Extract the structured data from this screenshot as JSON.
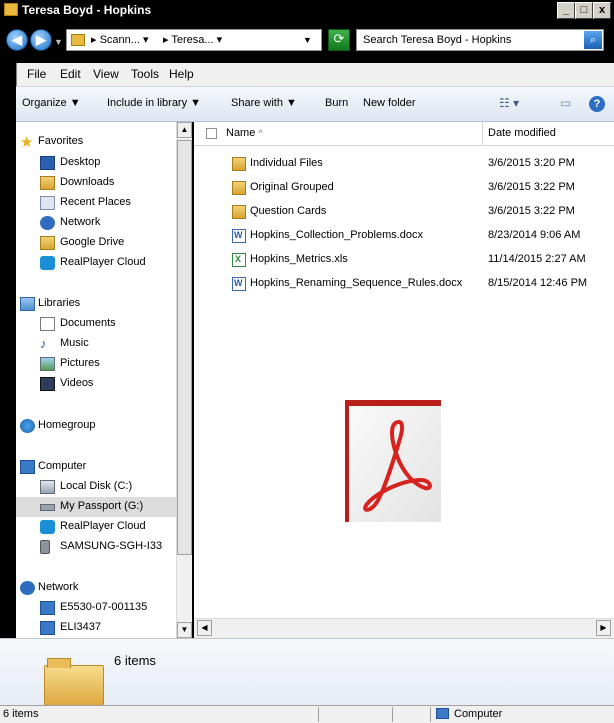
{
  "window": {
    "title": "Teresa Boyd - Hopkins",
    "buttons": {
      "minimize": "_",
      "maximize": "□",
      "close": "x"
    }
  },
  "address_bar": {
    "crumbs": [
      "▸ Scann... ▾",
      "▸ Teresa... ▾"
    ],
    "search_placeholder": "Search Teresa Boyd - Hopkins"
  },
  "menu": [
    "File",
    "Edit",
    "View",
    "Tools",
    "Help"
  ],
  "toolbar": {
    "organize": "Organize ▼",
    "include_in_library": "Include in library ▼",
    "share_with": "Share with ▼",
    "burn": "Burn",
    "new_folder": "New folder"
  },
  "nav": {
    "favorites_label": "Favorites",
    "favorites": [
      "Desktop",
      "Downloads",
      "Recent Places",
      "Network",
      "Google Drive",
      "RealPlayer Cloud"
    ],
    "libraries_label": "Libraries",
    "libraries": [
      "Documents",
      "Music",
      "Pictures",
      "Videos"
    ],
    "homegroup_label": "Homegroup",
    "computer_label": "Computer",
    "computer": [
      "Local Disk (C:)",
      "My Passport (G:)",
      "RealPlayer Cloud",
      "SAMSUNG-SGH-I33"
    ],
    "network_label": "Network",
    "network": [
      "E5530-07-001135",
      "ELI3437"
    ]
  },
  "columns": {
    "name": "Name",
    "date_modified": "Date modified",
    "sort_arrow": "^"
  },
  "files": [
    {
      "name": "Individual Files",
      "date": "3/6/2015 3:20 PM",
      "kind": "folder"
    },
    {
      "name": "Original Grouped",
      "date": "3/6/2015 3:22 PM",
      "kind": "folder"
    },
    {
      "name": "Question Cards",
      "date": "3/6/2015 3:22 PM",
      "kind": "folder"
    },
    {
      "name": "Hopkins_Collection_Problems.docx",
      "date": "8/23/2014 9:06 AM",
      "kind": "docx"
    },
    {
      "name": "Hopkins_Metrics.xls",
      "date": "11/14/2015 2:27 AM",
      "kind": "xls"
    },
    {
      "name": "Hopkins_Renaming_Sequence_Rules.docx",
      "date": "8/15/2014 12:46 PM",
      "kind": "docx"
    }
  ],
  "details": {
    "count": "6 items"
  },
  "status": {
    "items": "6 items",
    "location": "Computer"
  },
  "colors": {
    "selection": "#dcdcdc",
    "acrobat_red": "#d7231f",
    "titlebar": "#000000"
  }
}
